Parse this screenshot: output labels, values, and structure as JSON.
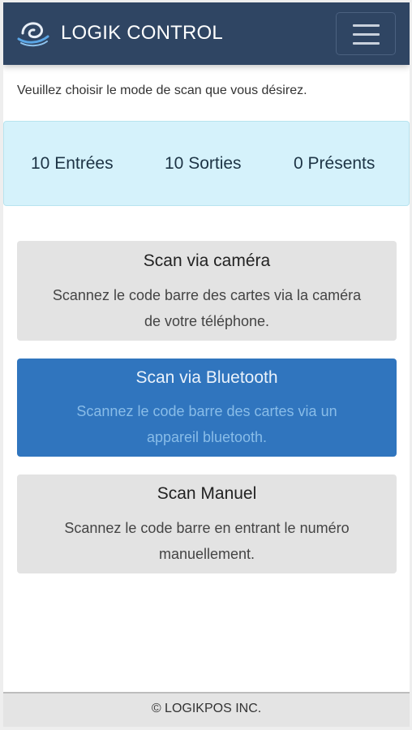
{
  "header": {
    "title": "LOGIK CONTROL",
    "logo_icon": "swirl-logo-icon",
    "menu_icon": "hamburger-menu-icon"
  },
  "instruction": "Veuillez choisir le mode de scan que vous désirez.",
  "stats": {
    "entries": "10 Entrées",
    "exits": "10 Sorties",
    "present": "0 Présents"
  },
  "scan_options": [
    {
      "title": "Scan via caméra",
      "description": "Scannez le code barre des cartes via la caméra de votre téléphone."
    },
    {
      "title": "Scan via Bluetooth",
      "description": "Scannez le code barre des cartes via un appareil bluetooth."
    },
    {
      "title": "Scan Manuel",
      "description": "Scannez le code barre en entrant le numéro manuellement."
    }
  ],
  "footer": {
    "copyright": "© LOGIKPOS INC."
  },
  "colors": {
    "navbar": "#2f4563",
    "stats_background": "#d5f2fb",
    "active_card": "#3075be",
    "card": "#e3e3e3"
  }
}
